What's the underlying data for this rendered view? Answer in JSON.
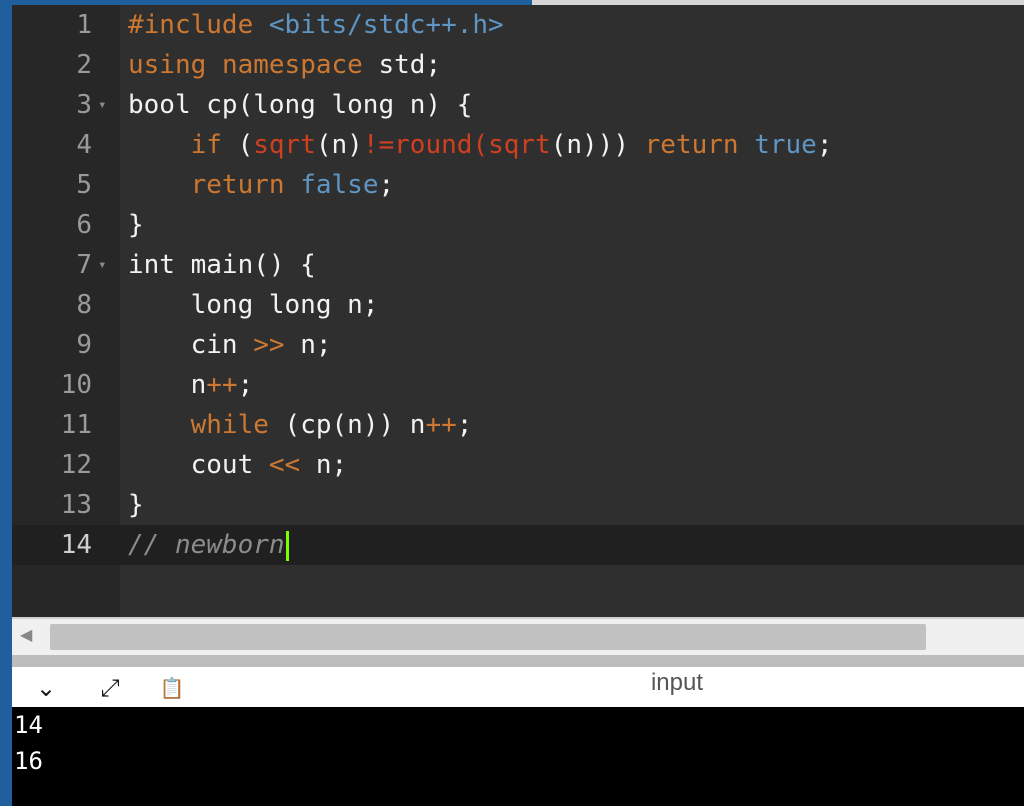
{
  "editor": {
    "lines": [
      {
        "num": "1"
      },
      {
        "num": "2"
      },
      {
        "num": "3"
      },
      {
        "num": "4"
      },
      {
        "num": "5"
      },
      {
        "num": "6"
      },
      {
        "num": "7"
      },
      {
        "num": "8"
      },
      {
        "num": "9"
      },
      {
        "num": "10"
      },
      {
        "num": "11"
      },
      {
        "num": "12"
      },
      {
        "num": "13"
      },
      {
        "num": "14"
      }
    ],
    "tokens": {
      "l1": {
        "a": "#include",
        "b": " ",
        "c": "<bits/stdc++.h>"
      },
      "l2": {
        "a": "using",
        "b": " ",
        "c": "namespace",
        "d": " std;"
      },
      "l3": {
        "a": "bool cp(long long n) {"
      },
      "l4": {
        "a": "    ",
        "b": "if",
        "c": " (",
        "d": "sqrt",
        "e": "(n)",
        "f": "!=",
        "g": "round",
        "h": "(",
        "i": "sqrt",
        "j": "(n))) ",
        "k": "return",
        "l": " ",
        "m": "true",
        "n": ";"
      },
      "l5": {
        "a": "    ",
        "b": "return",
        "c": " ",
        "d": "false",
        "e": ";"
      },
      "l6": {
        "a": "}"
      },
      "l7": {
        "a": "int main() {"
      },
      "l8": {
        "a": "    long long n;"
      },
      "l9": {
        "a": "    cin ",
        "b": ">>",
        "c": " n;"
      },
      "l10": {
        "a": "    n",
        "b": "++",
        "c": ";"
      },
      "l11": {
        "a": "    ",
        "b": "while",
        "c": " (cp(n)) n",
        "d": "++",
        "e": ";"
      },
      "l12": {
        "a": "    cout ",
        "b": "<<",
        "c": " n;"
      },
      "l13": {
        "a": "}"
      },
      "l14": {
        "a": "// newborn"
      }
    },
    "fold_glyph": "▾"
  },
  "panel": {
    "title": "input",
    "icons": {
      "collapse": "chevron-down-icon",
      "expand": "expand-arrows-icon",
      "clipboard": "clipboard-icon"
    },
    "glyphs": {
      "collapse": "⌄",
      "expand": "⤢",
      "clipboard": "📋"
    },
    "output": [
      "14",
      "16"
    ]
  },
  "colors": {
    "keyword": "#cc7832",
    "include_path": "#5f95c2",
    "function": "#d04020",
    "literal": "#5f95c2",
    "comment": "#8c8c8c",
    "cursor": "#7cff00",
    "accent": "#1f5f9e"
  }
}
